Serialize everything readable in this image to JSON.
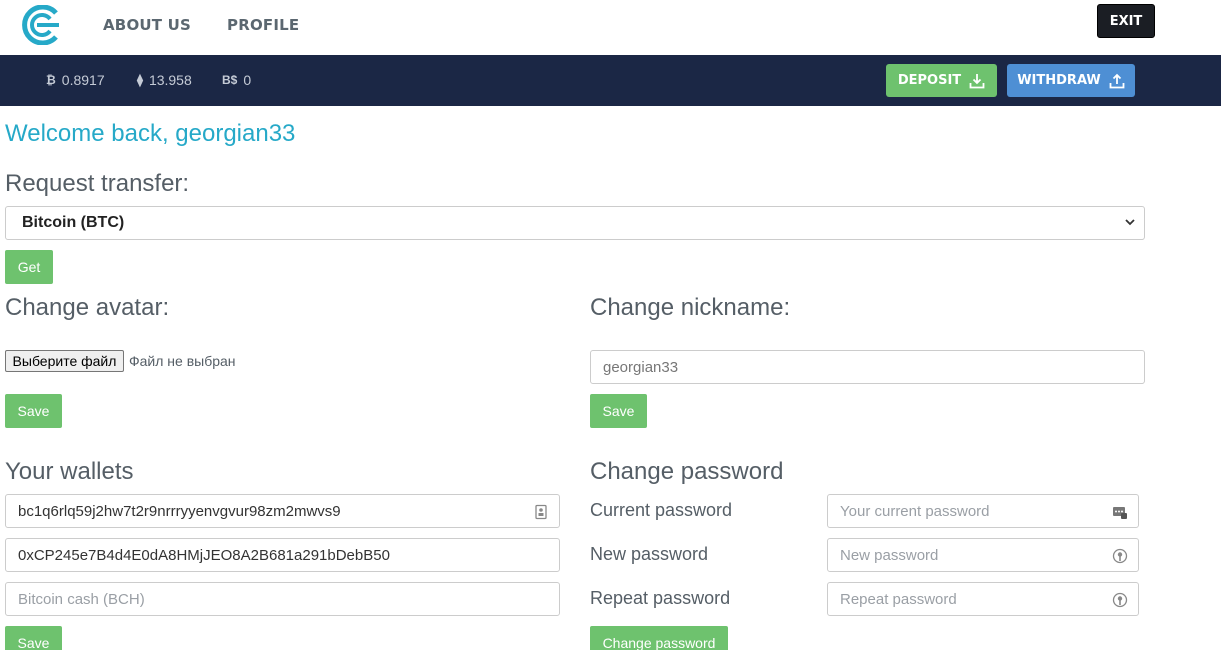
{
  "nav": {
    "about": "ABOUT US",
    "profile": "PROFILE",
    "exit": "EXIT"
  },
  "balances": [
    {
      "icon": "bitcoin-icon",
      "glyph": "₿",
      "value": "0.8917"
    },
    {
      "icon": "ethereum-icon",
      "glyph": "⧫",
      "value": "13.958"
    },
    {
      "icon": "bitcoin-cash-icon",
      "glyph": "B$",
      "value": "0"
    }
  ],
  "actions": {
    "deposit": "DEPOSIT",
    "withdraw": "WITHDRAW"
  },
  "welcome": "Welcome back, georgian33",
  "request": {
    "heading": "Request transfer:",
    "selected": "Bitcoin (BTC)",
    "button": "Get"
  },
  "avatar": {
    "heading": "Change avatar:",
    "file_button": "Выберите файл",
    "file_status": "Файл не выбран",
    "save": "Save"
  },
  "nickname": {
    "heading": "Change nickname:",
    "value": "georgian33",
    "save": "Save"
  },
  "wallets": {
    "heading": "Your wallets",
    "btc_value": "bc1q6rlq59j2hw7t2r9nrrryyenvgvur98zm2mwvs9",
    "eth_value": "0xCP245e7B4d4E0dA8HMjJEO8A2B681a291bDebB50",
    "bch_placeholder": "Bitcoin cash (BCH)",
    "save": "Save"
  },
  "password": {
    "heading": "Change password",
    "current_label": "Current password",
    "current_placeholder": "Your current password",
    "new_label": "New password",
    "new_placeholder": "New password",
    "repeat_label": "Repeat password",
    "repeat_placeholder": "Repeat password",
    "button": "Change password"
  },
  "colors": {
    "brand_teal": "#26a9c8",
    "navy_bar": "#1b2745",
    "green": "#6ec26e",
    "blue": "#4e8fd4"
  }
}
